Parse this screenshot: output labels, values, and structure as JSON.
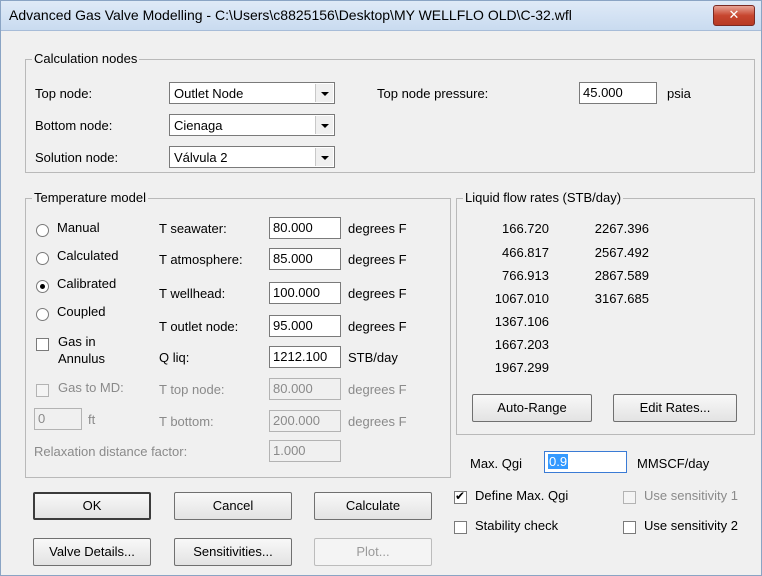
{
  "window": {
    "title": "Advanced Gas Valve Modelling - C:\\Users\\c8825156\\Desktop\\MY WELLFLO OLD\\C-32.wfl",
    "close_glyph": "✕"
  },
  "calc_nodes": {
    "title": "Calculation nodes",
    "top_node_label": "Top node:",
    "top_node_value": "Outlet Node",
    "bottom_node_label": "Bottom node:",
    "bottom_node_value": "Cienaga",
    "solution_node_label": "Solution node:",
    "solution_node_value": "Válvula 2",
    "top_pressure_label": "Top node pressure:",
    "top_pressure_value": "45.000",
    "top_pressure_unit": "psia"
  },
  "temp_model": {
    "title": "Temperature model",
    "options": [
      "Manual",
      "Calculated",
      "Calibrated",
      "Coupled"
    ],
    "selected": "Calibrated",
    "gas_in_annulus_1": "Gas in",
    "gas_in_annulus_2": "Annulus",
    "gas_to_md": "Gas to MD:",
    "md_value": "0",
    "md_unit": "ft",
    "relaxation_label": "Relaxation distance factor:",
    "relaxation_value": "1.000",
    "rows": [
      {
        "label": "T seawater:",
        "value": "80.000",
        "unit": "degrees F"
      },
      {
        "label": "T atmosphere:",
        "value": "85.000",
        "unit": "degrees F"
      },
      {
        "label": "T wellhead:",
        "value": "100.000",
        "unit": "degrees F"
      },
      {
        "label": "T outlet node:",
        "value": "95.000",
        "unit": "degrees F"
      },
      {
        "label": "Q liq:",
        "value": "1212.100",
        "unit": "STB/day"
      },
      {
        "label": "T top node:",
        "value": "80.000",
        "unit": "degrees F"
      },
      {
        "label": "T bottom:",
        "value": "200.000",
        "unit": "degrees F"
      }
    ]
  },
  "liquid_rates": {
    "title": "Liquid flow rates (STB/day)",
    "col1": [
      "166.720",
      "466.817",
      "766.913",
      "1067.010",
      "1367.106",
      "1667.203",
      "1967.299"
    ],
    "col2": [
      "2267.396",
      "2567.492",
      "2867.589",
      "3167.685"
    ],
    "auto_range": "Auto-Range",
    "edit_rates": "Edit Rates..."
  },
  "qgi": {
    "label": "Max. Qgi",
    "value": "0.9",
    "unit": "MMSCF/day"
  },
  "checks": {
    "define_max_qgi": "Define Max. Qgi",
    "stability_check": "Stability check",
    "use_sens_1": "Use sensitivity 1",
    "use_sens_2": "Use sensitivity 2"
  },
  "buttons": {
    "ok": "OK",
    "cancel": "Cancel",
    "calculate": "Calculate",
    "valve_details": "Valve Details...",
    "sensitivities": "Sensitivities...",
    "plot": "Plot..."
  }
}
